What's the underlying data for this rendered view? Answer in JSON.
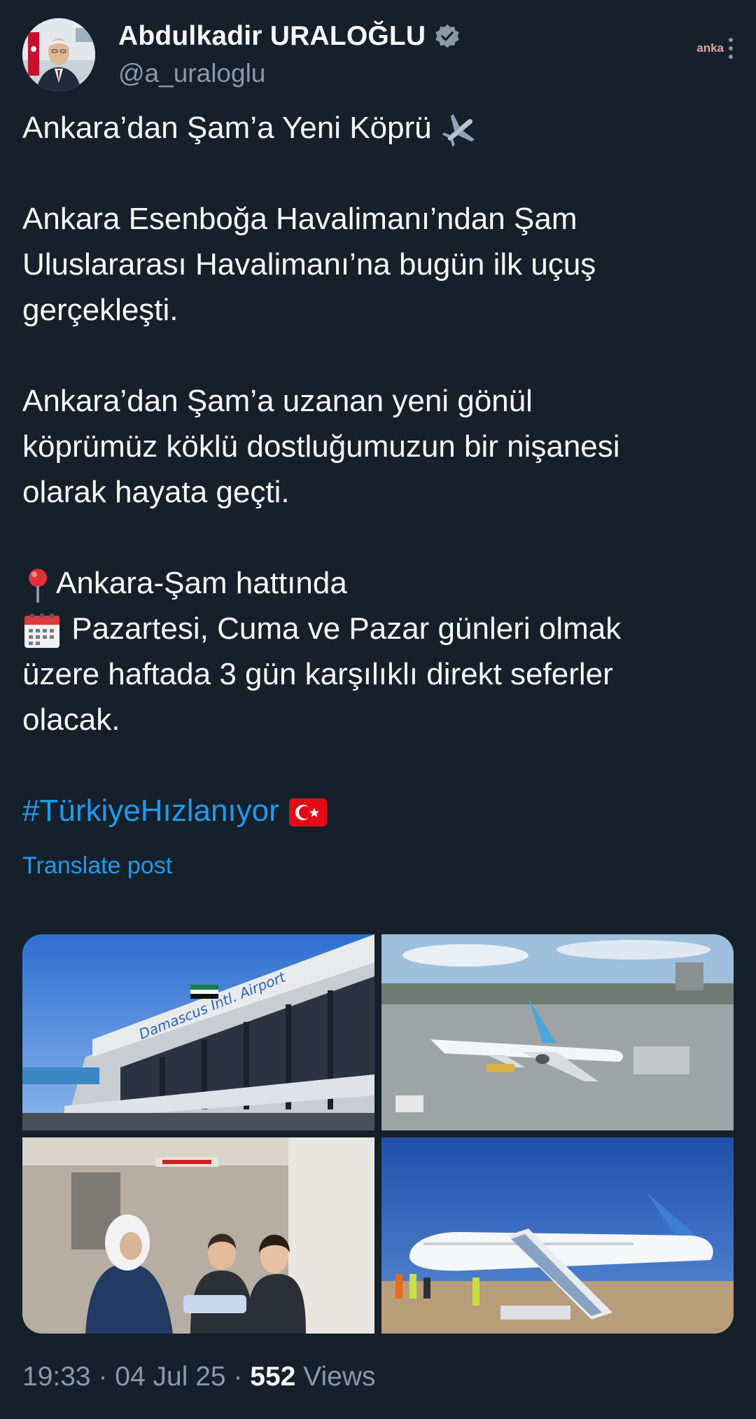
{
  "author": {
    "name": "Abdulkadir URALOĞLU",
    "handle": "@a_uraloglu",
    "verified": true,
    "avatar": "avatar-portrait"
  },
  "header": {
    "watermark": "anka",
    "more_icon": "vertical-dots-icon"
  },
  "post": {
    "title_line": "Ankara’dan Şam’a Yeni Köprü",
    "title_emoji": "✈️",
    "paragraph_1": [
      "Ankara Esenboğa Havalimanı’ndan Şam",
      "Uluslararası Havalimanı’na bugün ilk uçuş",
      "gerçekleşti."
    ],
    "paragraph_2": [
      "Ankara’dan Şam’a uzanan yeni gönül",
      "köprümüz köklü dostluğumuzun bir nişanesi",
      "olarak hayata geçti."
    ],
    "pin_line": "Ankara-Şam hattında",
    "calendar_lines": [
      "Pazartesi, Cuma ve Pazar günleri olmak",
      "üzere haftada 3 gün karşılıklı direkt seferler",
      "olacak."
    ],
    "hashtag": "#TürkiyeHızlanıyor"
  },
  "translate_label": "Translate post",
  "media": [
    {
      "label": "airport-terminal-photo"
    },
    {
      "label": "airplane-on-apron-photo"
    },
    {
      "label": "cabin-crew-welcome-photo"
    },
    {
      "label": "passengers-boarding-stairs-photo"
    }
  ],
  "media_text": {
    "terminal_sign": "Damascus Intl. Airport"
  },
  "meta": {
    "time": "19:33",
    "date": "04 Jul 25",
    "views_count": "552",
    "views_label": "Views",
    "separator": "·"
  },
  "colors": {
    "background": "#15202b",
    "text": "#f7f9f9",
    "secondary": "#8b98a5",
    "link": "#1d9bf0"
  }
}
